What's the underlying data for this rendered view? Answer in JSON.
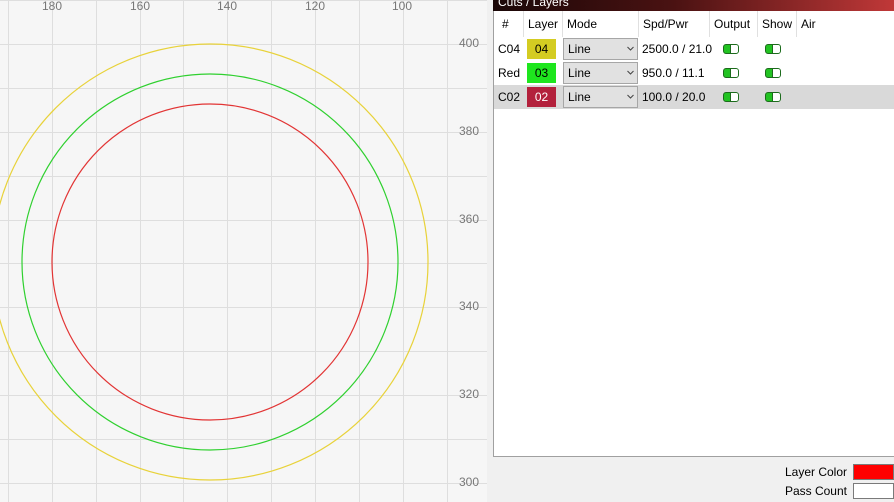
{
  "ruler": {
    "x_ticks": [
      "180",
      "160",
      "140",
      "120",
      "100"
    ],
    "y_ticks": [
      "400",
      "380",
      "360",
      "340",
      "320",
      "300"
    ]
  },
  "canvas": {
    "circle_colors": [
      "#e8d23a",
      "#2fd02f",
      "#e23434"
    ]
  },
  "panel": {
    "title": "Cuts / Layers",
    "columns": {
      "num": "#",
      "layer": "Layer",
      "mode": "Mode",
      "spd_pwr": "Spd/Pwr",
      "output": "Output",
      "show": "Show",
      "air": "Air"
    },
    "rows": [
      {
        "num": "C04",
        "layer": "04",
        "color": "#d4cc22",
        "text_color": "#000000",
        "mode": "Line",
        "spd_pwr": "2500.0 / 21.0",
        "output": true,
        "show": true,
        "selected": false
      },
      {
        "num": "Red",
        "layer": "03",
        "color": "#1ee61e",
        "text_color": "#000000",
        "mode": "Line",
        "spd_pwr": "950.0 / 11.1",
        "output": true,
        "show": true,
        "selected": false
      },
      {
        "num": "C02",
        "layer": "02",
        "color": "#b3213c",
        "text_color": "#ffffff",
        "mode": "Line",
        "spd_pwr": "100.0 / 20.0",
        "output": true,
        "show": true,
        "selected": true
      }
    ]
  },
  "properties": {
    "layer_color_label": "Layer Color",
    "layer_color": "#ff0000",
    "pass_count_label": "Pass Count",
    "pass_count": ""
  },
  "colors": {
    "toggle_on": "#22c322",
    "title_gradient_end": "#c03838"
  }
}
